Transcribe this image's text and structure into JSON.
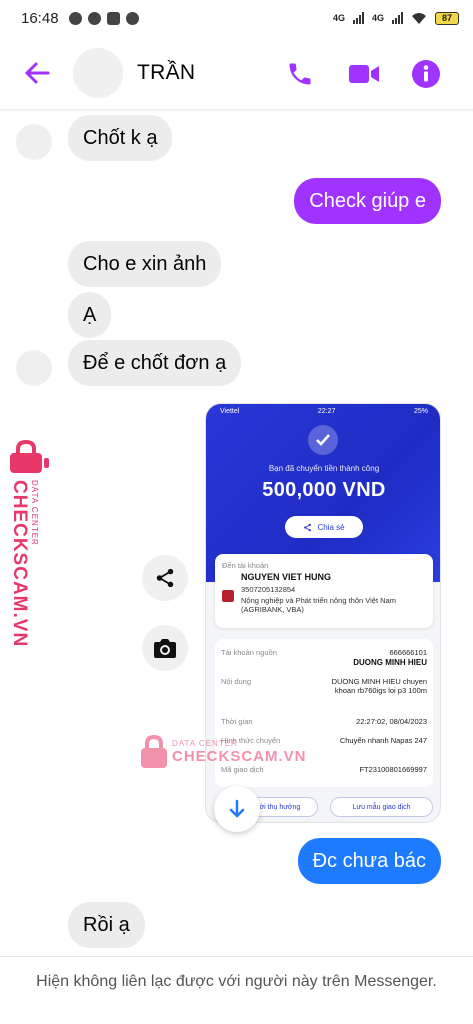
{
  "status_bar": {
    "time": "16:48",
    "network_1": "4G",
    "network_2": "4G",
    "battery": "87"
  },
  "header": {
    "contact_name": "TRẦN",
    "accent_color": "#a033ff"
  },
  "messages": [
    {
      "direction": "in",
      "text": "Chốt k ạ"
    },
    {
      "direction": "out",
      "text": "Check giúp e"
    },
    {
      "direction": "in",
      "text": "Cho e xin ảnh"
    },
    {
      "direction": "in",
      "text": "Ạ"
    },
    {
      "direction": "in",
      "text": "Để e chốt đơn ạ"
    },
    {
      "direction": "out",
      "text": "Đc chưa bác"
    },
    {
      "direction": "in",
      "text": "Rồi ạ"
    }
  ],
  "receipt": {
    "status_carrier": "Viettel",
    "status_time": "22:27",
    "status_battery": "25%",
    "success_text": "Bạn đã chuyển tiền thành công",
    "amount": "500,000 VND",
    "share_label": "Chia sẻ",
    "to_account_label": "Đến tài khoản",
    "recipient_name": "NGUYEN VIET HUNG",
    "recipient_account": "3507205132854",
    "recipient_bank": "Nông nghiệp và Phát triển nông thôn Việt Nam (AGRIBANK, VBA)",
    "source_label": "Tài khoản nguồn",
    "source_account": "666666101",
    "source_name": "DUONG MINH HIEU",
    "content_label": "Nội dung",
    "content_value": "DUONG MINH HIEU chuyen khoan rb760igs loi p3 100m",
    "time_label": "Thời gian",
    "time_value": "22:27:02, 08/04/2023",
    "method_label": "Hình thức chuyển",
    "method_value": "Chuyển nhanh Napas 247",
    "txn_label": "Mã giao dịch",
    "txn_value": "FT23100801669997",
    "save_recipient": "Lưu người thụ hưởng",
    "save_template": "Lưu mẫu giao dịch"
  },
  "watermark": {
    "side_main": "CHECKSCAM.VN",
    "side_sub": "DATA CENTER",
    "mid_sub": "DATA CENTER",
    "mid_main": "CHECKSCAM.VN",
    "color": "#e8386a"
  },
  "footer": {
    "notice": "Hiện không liên lạc được với người này trên Messenger."
  }
}
